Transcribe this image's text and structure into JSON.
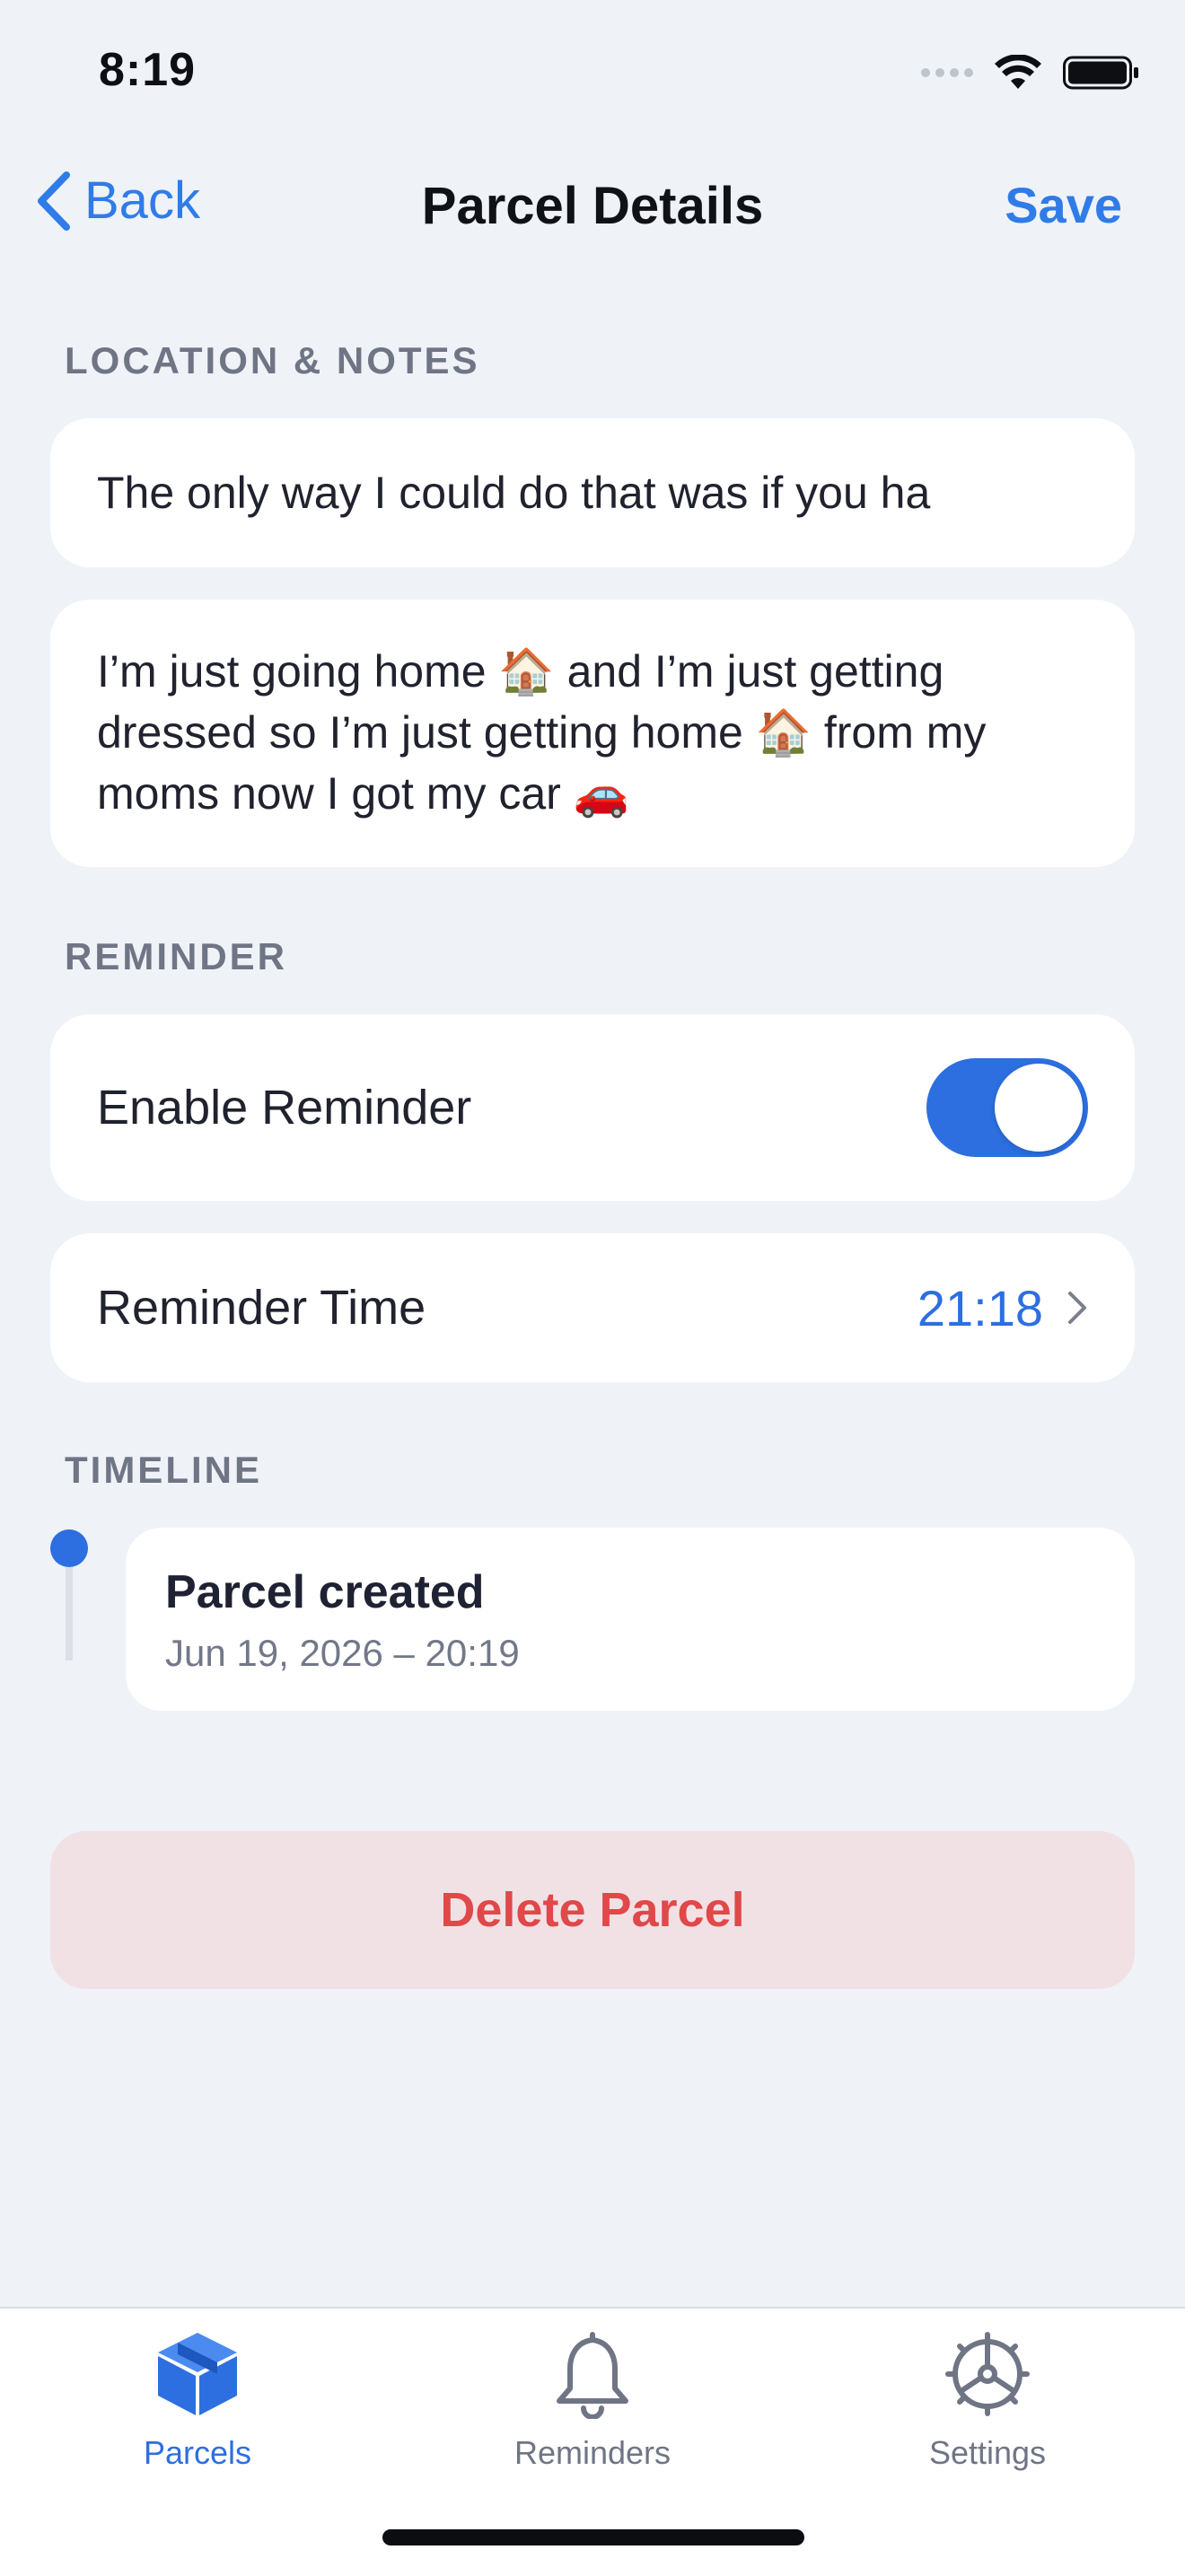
{
  "status_bar": {
    "time": "8:19"
  },
  "nav": {
    "back_label": "Back",
    "title": "Parcel Details",
    "save_label": "Save"
  },
  "location_notes": {
    "header": "LOCATION & NOTES",
    "location_value": "The only way I could do that was if you ha",
    "notes_value": "I’m just going home 🏠 and I’m just getting dressed so I’m just getting home 🏠 from my moms now I got my car 🚗"
  },
  "reminder": {
    "header": "REMINDER",
    "enable_label": "Enable Reminder",
    "enabled": true,
    "time_label": "Reminder Time",
    "time_value": "21:18"
  },
  "timeline": {
    "header": "TIMELINE",
    "events": [
      {
        "title": "Parcel created",
        "date": "Jun 19, 2026 – 20:19"
      }
    ]
  },
  "delete_label": "Delete Parcel",
  "tab_bar": {
    "tabs": [
      {
        "label": "Parcels",
        "icon": "box-icon",
        "active": true
      },
      {
        "label": "Reminders",
        "icon": "bell-icon",
        "active": false
      },
      {
        "label": "Settings",
        "icon": "gear-icon",
        "active": false
      }
    ]
  },
  "colors": {
    "accent": "#2D6FE0",
    "background": "#EFF2F7",
    "destructive": "#E0484A",
    "destructive_bg": "#F1E1E5",
    "inactive_tab": "#6F7585"
  }
}
